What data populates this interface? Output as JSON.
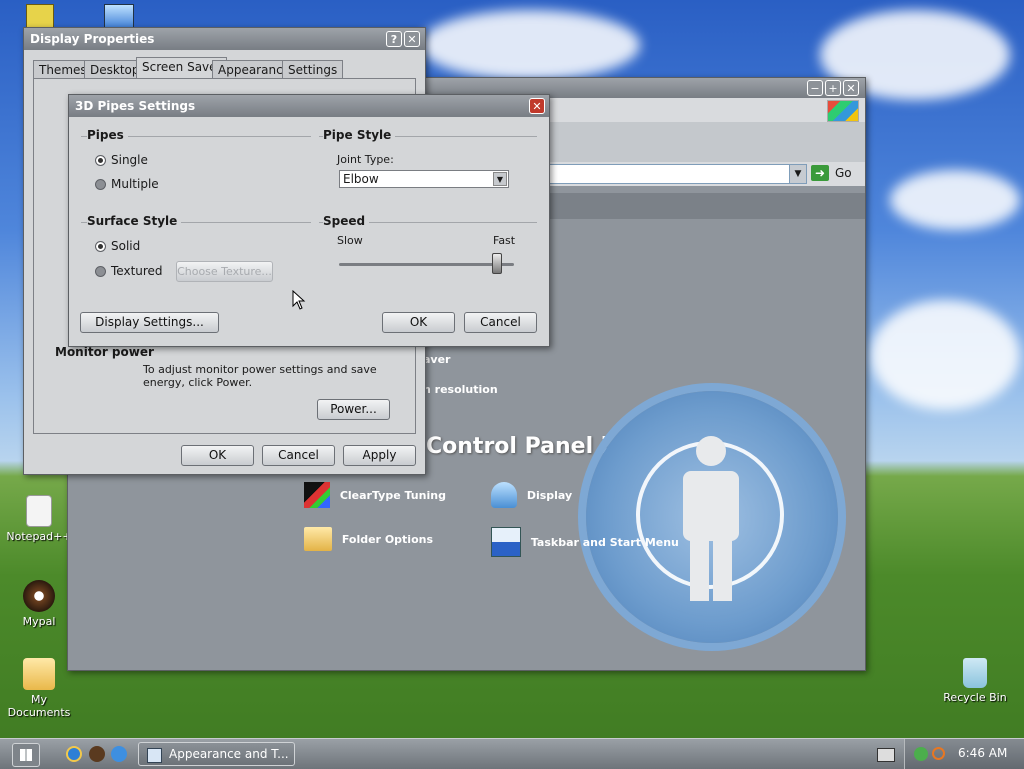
{
  "desktop": {
    "icons": [
      {
        "label": "Notepad++",
        "name": "notepadpp"
      },
      {
        "label": "Mypal",
        "name": "mypal"
      },
      {
        "label": "My Documents",
        "name": "my-documents"
      },
      {
        "label": "Recycle Bin",
        "name": "recycle-bin"
      }
    ]
  },
  "display_properties": {
    "title": "Display Properties",
    "tabs": [
      "Themes",
      "Desktop",
      "Screen Saver",
      "Appearance",
      "Settings"
    ],
    "active_tab": "Screen Saver",
    "monitor_power_label": "Monitor power",
    "monitor_power_text": "To adjust monitor power settings and save energy, click Power.",
    "power_button": "Power...",
    "ok": "OK",
    "cancel": "Cancel",
    "apply": "Apply",
    "help_glyph": "?",
    "close_glyph": "✕"
  },
  "pipes_settings": {
    "title": "3D Pipes Settings",
    "pipes_label": "Pipes",
    "pipes_options": [
      "Single",
      "Multiple"
    ],
    "pipes_selected": "Single",
    "pipe_style_label": "Pipe Style",
    "joint_type_label": "Joint Type:",
    "joint_type_value": "Elbow",
    "surface_style_label": "Surface Style",
    "surface_options": [
      "Solid",
      "Textured"
    ],
    "surface_selected": "Solid",
    "choose_texture": "Choose Texture...",
    "speed_label": "Speed",
    "speed_slow": "Slow",
    "speed_fast": "Fast",
    "speed_value": 0.9,
    "display_settings": "Display Settings...",
    "ok": "OK",
    "cancel": "Cancel",
    "close_glyph": "✕"
  },
  "control_panel": {
    "go_label": "Go",
    "header": "Control Panel icon",
    "partial_items": [
      "aver",
      "n resolution"
    ],
    "items": [
      "ClearType Tuning",
      "Display",
      "Folder Options",
      "Taskbar and Start Menu"
    ],
    "min_glyph": "−",
    "max_glyph": "+",
    "close_glyph": "✕"
  },
  "taskbar": {
    "task_label": "Appearance and T...",
    "clock": "6:46 AM"
  },
  "colors": {
    "titlebar": "#7f848b",
    "cp_background": "#8f959c",
    "taskbar": "#7c8288"
  }
}
